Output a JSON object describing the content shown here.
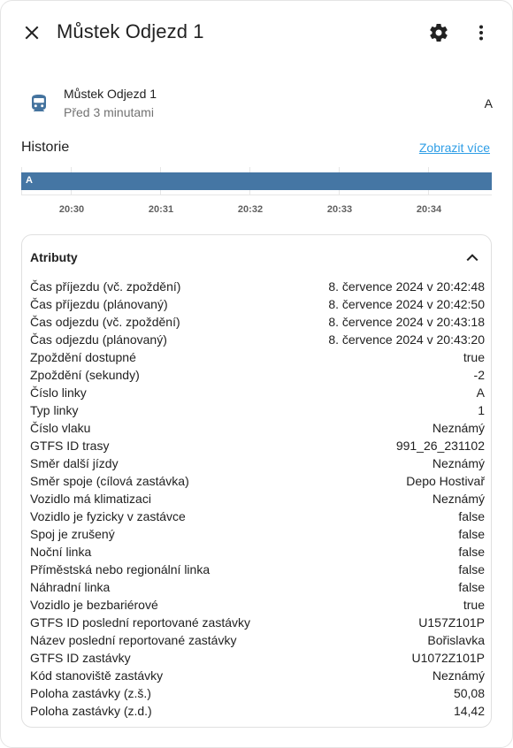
{
  "header": {
    "title": "Můstek Odjezd 1"
  },
  "entity": {
    "name": "Můstek Odjezd 1",
    "relative_time": "Před 3 minutami",
    "state": "A"
  },
  "history": {
    "title": "Historie",
    "more_link": "Zobrazit více",
    "bar_label": "A",
    "ticks": [
      "20:30",
      "20:31",
      "20:32",
      "20:33",
      "20:34"
    ],
    "bar_color": "#4576a4"
  },
  "attributes": {
    "title": "Atributy",
    "items": [
      {
        "name": "Čas příjezdu (vč. zpoždění)",
        "value": "8. července 2024 v 20:42:48"
      },
      {
        "name": "Čas příjezdu (plánovaný)",
        "value": "8. července 2024 v 20:42:50"
      },
      {
        "name": "Čas odjezdu (vč. zpoždění)",
        "value": "8. července 2024 v 20:43:18"
      },
      {
        "name": "Čas odjezdu (plánovaný)",
        "value": "8. července 2024 v 20:43:20"
      },
      {
        "name": "Zpoždění dostupné",
        "value": "true"
      },
      {
        "name": "Zpoždění (sekundy)",
        "value": "-2"
      },
      {
        "name": "Číslo linky",
        "value": "A"
      },
      {
        "name": "Typ linky",
        "value": "1"
      },
      {
        "name": "Číslo vlaku",
        "value": "Neznámý"
      },
      {
        "name": "GTFS ID trasy",
        "value": "991_26_231102"
      },
      {
        "name": "Směr další jízdy",
        "value": "Neznámý"
      },
      {
        "name": "Směr spoje (cílová zastávka)",
        "value": "Depo Hostivař"
      },
      {
        "name": "Vozidlo má klimatizaci",
        "value": "Neznámý"
      },
      {
        "name": "Vozidlo je fyzicky v zastávce",
        "value": "false"
      },
      {
        "name": "Spoj je zrušený",
        "value": "false"
      },
      {
        "name": "Noční linka",
        "value": "false"
      },
      {
        "name": "Příměstská nebo regionální linka",
        "value": "false"
      },
      {
        "name": "Náhradní linka",
        "value": "false"
      },
      {
        "name": "Vozidlo je bezbariérové",
        "value": "true"
      },
      {
        "name": "GTFS ID poslední reportované zastávky",
        "value": "U157Z101P"
      },
      {
        "name": "Název poslední reportované zastávky",
        "value": "Bořislavka"
      },
      {
        "name": "GTFS ID zastávky",
        "value": "U1072Z101P"
      },
      {
        "name": "Kód stanoviště zastávky",
        "value": "Neznámý"
      },
      {
        "name": "Poloha zastávky (z.š.)",
        "value": "50,08"
      },
      {
        "name": "Poloha zastávky (z.d.)",
        "value": "14,42"
      }
    ]
  },
  "icons": {
    "close": "close-icon",
    "settings": "gear-icon",
    "more": "more-vertical-icon",
    "entity": "train-icon",
    "collapse": "chevron-up-icon"
  },
  "colors": {
    "accent_link": "#2f9ee6",
    "icon_gray": "#44739e"
  }
}
